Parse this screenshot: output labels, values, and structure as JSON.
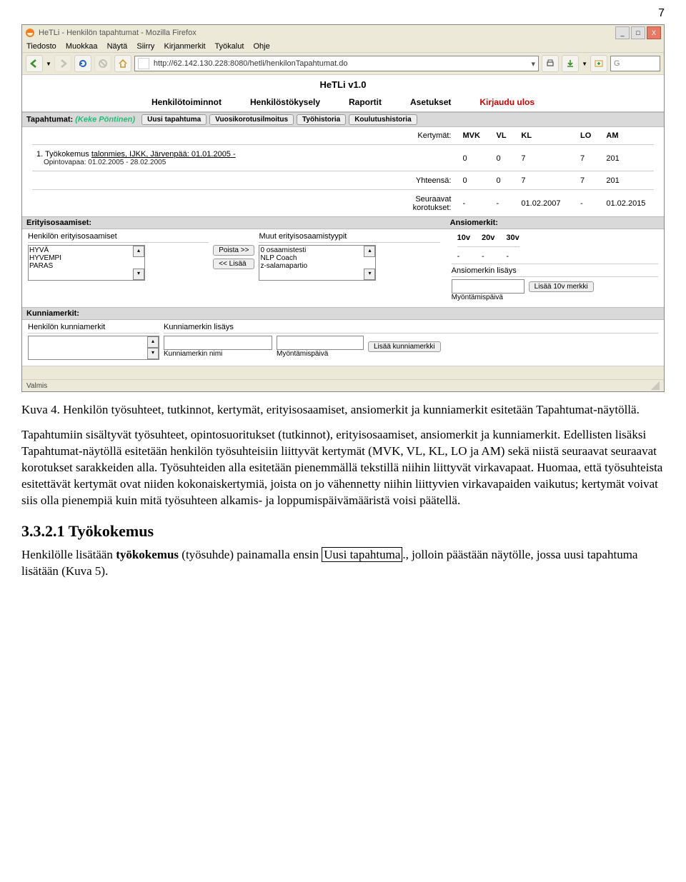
{
  "page_number": "7",
  "firefox": {
    "title": "HeTLi - Henkilön tapahtumat - Mozilla Firefox",
    "menus": [
      "Tiedosto",
      "Muokkaa",
      "Näytä",
      "Siirry",
      "Kirjanmerkit",
      "Työkalut",
      "Ohje"
    ],
    "url": "http://62.142.130.228:8080/hetli/henkilonTapahtumat.do",
    "status": "Valmis",
    "win_min": "_",
    "win_max": "□",
    "win_close": "X",
    "search_placeholder": "G"
  },
  "app": {
    "title": "HeTLi v1.0",
    "nav": [
      "Henkilötoiminnot",
      "Henkilöstökysely",
      "Raportit",
      "Asetukset"
    ],
    "logout": "Kirjaudu ulos"
  },
  "tapahtumat": {
    "label": "Tapahtumat:",
    "user": "(Keke Pöntinen)",
    "buttons": [
      "Uusi tapahtuma",
      "Vuosikorotusilmoitus",
      "Työhistoria",
      "Koulutushistoria"
    ],
    "kert_label": "Kertymät:",
    "headers": [
      "MVK",
      "VL",
      "KL",
      "LO",
      "AM"
    ],
    "row1": {
      "index": "1.",
      "text": "Työkokemus talonmies, IJKK, Järvenpää: 01.01.2005 -",
      "link_text": "talonmies, IJKK, Järvenpää: 01.01.2005 -",
      "sub": "Opintovapaa: 01.02.2005 - 28.02.2005",
      "values": [
        "0",
        "0",
        "7",
        "7",
        "201"
      ]
    },
    "yhteensa_label": "Yhteensä:",
    "yhteensa": [
      "0",
      "0",
      "7",
      "7",
      "201"
    ],
    "seuraavat_label": "Seuraavat korotukset:",
    "seuraavat": [
      "-",
      "-",
      "01.02.2007",
      "-",
      "01.02.2015"
    ]
  },
  "erityis": {
    "head": "Erityisosaamiset:",
    "left_label": "Henkilön erityisosaamiset",
    "right_label": "Muut erityisosaamistyypit",
    "left_items": [
      "HYVÄ",
      "HYVEMPI",
      "PARAS"
    ],
    "right_items": [
      "0 osaamistesti",
      "NLP Coach",
      "z-salamapartio"
    ],
    "btn_poista": "Poista >>",
    "btn_lisaa": "<< Lisää"
  },
  "ansio": {
    "head": "Ansiomerkit:",
    "headers": [
      "10v",
      "20v",
      "30v"
    ],
    "values": [
      "-",
      "-",
      "-"
    ],
    "lisays_label": "Ansiomerkin lisäys",
    "btn_lisaa": "Lisää 10v merkki",
    "sub_label": "Myöntämispäivä"
  },
  "kunnia": {
    "head": "Kunniamerkit:",
    "left_label": "Henkilön kunniamerkit",
    "right_label": "Kunniamerkin lisäys",
    "name_label": "Kunniamerkin nimi",
    "date_label": "Myöntämispäivä",
    "btn": "Lisää kunniamerkki"
  },
  "caption": "Kuva 4. Henkilön työsuhteet, tutkinnot, kertymät, erityisosaamiset, ansiomerkit ja kunniamerkit esitetään Tapahtumat-näytöllä.",
  "paragraph": "Tapahtumiin sisältyvät työsuhteet, opintosuoritukset (tutkinnot), erityisosaamiset, ansiomerkit ja kunniamerkit. Edellisten lisäksi Tapahtumat-näytöllä esitetään henkilön työsuhteisiin liittyvät kertymät (MVK, VL, KL, LO ja AM) sekä niistä seuraavat seuraavat korotukset sarakkeiden alla. Työsuhteiden alla esitetään pienemmällä tekstillä niihin liittyvät virkavapaat. Huomaa, että työsuhteista esitettävät kertymät ovat niiden kokonaiskertymiä, joista on jo vähennetty niihin liittyvien virkavapaiden vaikutus; kertymät voivat siis olla pienempiä kuin mitä työsuhteen alkamis- ja loppumispäivämääristä voisi päätellä.",
  "heading": "3.3.2.1 Työkokemus",
  "para2_pre": "Henkilölle lisätään ",
  "para2_bold": "työkokemus",
  "para2_mid": " (työsuhde) painamalla ensin ",
  "para2_box": "Uusi tapahtuma",
  "para2_post": "., jolloin päästään näytölle, jossa uusi tapahtuma lisätään (Kuva 5)."
}
